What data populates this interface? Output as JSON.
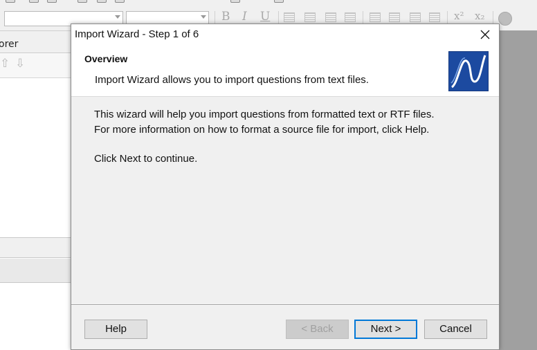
{
  "app": {
    "explorer_title": "orer"
  },
  "toolbar": {
    "bold_glyph": "B",
    "italic_glyph": "I",
    "underline_glyph": "U",
    "superscript_glyph": "x²",
    "subscript_glyph": "x₂"
  },
  "dialog": {
    "title": "Import Wizard - Step 1 of 6",
    "header_title": "Overview",
    "header_subtitle": "Import Wizard allows you to import questions from text files.",
    "body_line1": "This wizard will help you import questions from formatted text or RTF files.",
    "body_line2": "For more information on how to format a source file for import, click Help.",
    "body_line3": "Click Next to continue.",
    "buttons": {
      "help": "Help",
      "back": "< Back",
      "next": "Next >",
      "cancel": "Cancel"
    },
    "logo_colors": {
      "background": "#1c4aa0",
      "stroke": "#ffffff"
    }
  }
}
